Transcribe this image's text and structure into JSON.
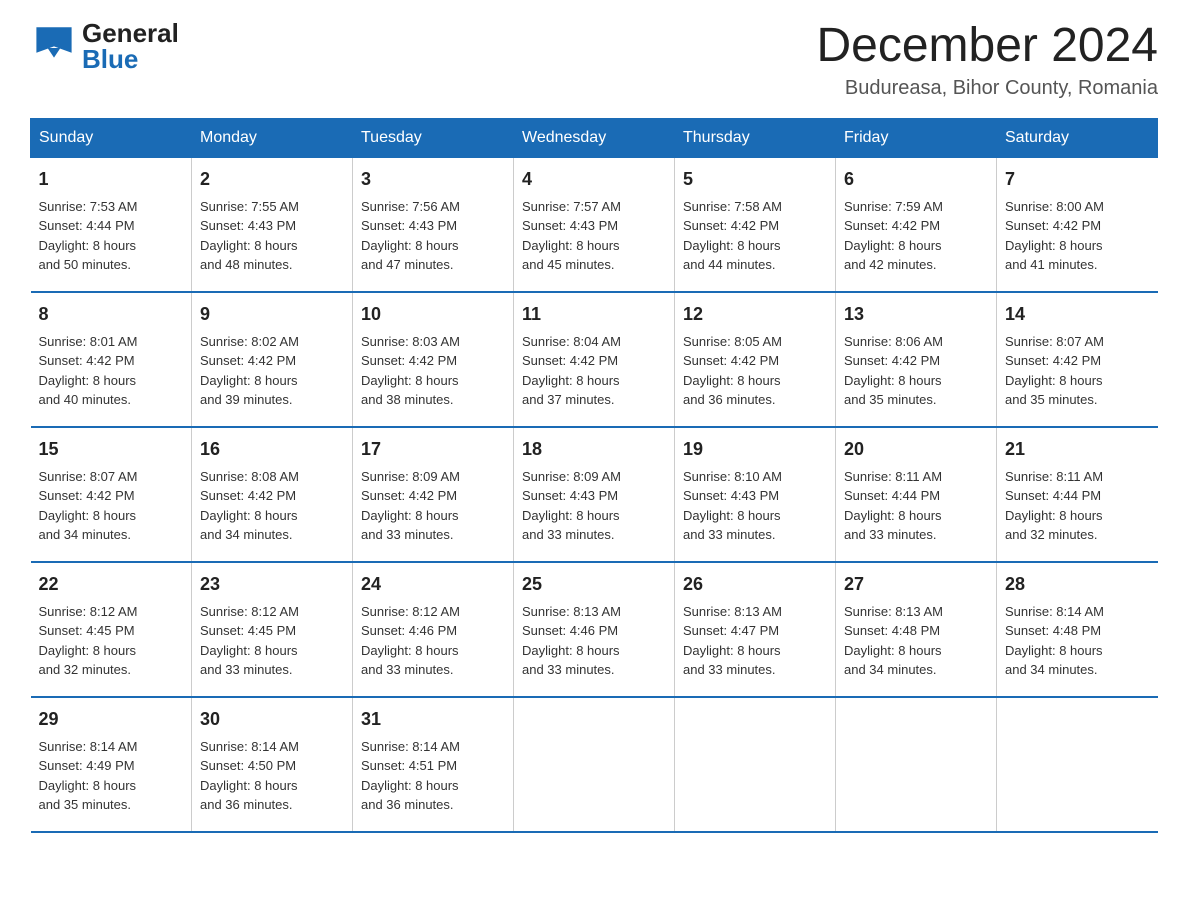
{
  "header": {
    "logo_general": "General",
    "logo_blue": "Blue",
    "month_title": "December 2024",
    "location": "Budureasa, Bihor County, Romania"
  },
  "days_of_week": [
    "Sunday",
    "Monday",
    "Tuesday",
    "Wednesday",
    "Thursday",
    "Friday",
    "Saturday"
  ],
  "weeks": [
    [
      {
        "day": "1",
        "sunrise": "7:53 AM",
        "sunset": "4:44 PM",
        "daylight": "8 hours and 50 minutes."
      },
      {
        "day": "2",
        "sunrise": "7:55 AM",
        "sunset": "4:43 PM",
        "daylight": "8 hours and 48 minutes."
      },
      {
        "day": "3",
        "sunrise": "7:56 AM",
        "sunset": "4:43 PM",
        "daylight": "8 hours and 47 minutes."
      },
      {
        "day": "4",
        "sunrise": "7:57 AM",
        "sunset": "4:43 PM",
        "daylight": "8 hours and 45 minutes."
      },
      {
        "day": "5",
        "sunrise": "7:58 AM",
        "sunset": "4:42 PM",
        "daylight": "8 hours and 44 minutes."
      },
      {
        "day": "6",
        "sunrise": "7:59 AM",
        "sunset": "4:42 PM",
        "daylight": "8 hours and 42 minutes."
      },
      {
        "day": "7",
        "sunrise": "8:00 AM",
        "sunset": "4:42 PM",
        "daylight": "8 hours and 41 minutes."
      }
    ],
    [
      {
        "day": "8",
        "sunrise": "8:01 AM",
        "sunset": "4:42 PM",
        "daylight": "8 hours and 40 minutes."
      },
      {
        "day": "9",
        "sunrise": "8:02 AM",
        "sunset": "4:42 PM",
        "daylight": "8 hours and 39 minutes."
      },
      {
        "day": "10",
        "sunrise": "8:03 AM",
        "sunset": "4:42 PM",
        "daylight": "8 hours and 38 minutes."
      },
      {
        "day": "11",
        "sunrise": "8:04 AM",
        "sunset": "4:42 PM",
        "daylight": "8 hours and 37 minutes."
      },
      {
        "day": "12",
        "sunrise": "8:05 AM",
        "sunset": "4:42 PM",
        "daylight": "8 hours and 36 minutes."
      },
      {
        "day": "13",
        "sunrise": "8:06 AM",
        "sunset": "4:42 PM",
        "daylight": "8 hours and 35 minutes."
      },
      {
        "day": "14",
        "sunrise": "8:07 AM",
        "sunset": "4:42 PM",
        "daylight": "8 hours and 35 minutes."
      }
    ],
    [
      {
        "day": "15",
        "sunrise": "8:07 AM",
        "sunset": "4:42 PM",
        "daylight": "8 hours and 34 minutes."
      },
      {
        "day": "16",
        "sunrise": "8:08 AM",
        "sunset": "4:42 PM",
        "daylight": "8 hours and 34 minutes."
      },
      {
        "day": "17",
        "sunrise": "8:09 AM",
        "sunset": "4:42 PM",
        "daylight": "8 hours and 33 minutes."
      },
      {
        "day": "18",
        "sunrise": "8:09 AM",
        "sunset": "4:43 PM",
        "daylight": "8 hours and 33 minutes."
      },
      {
        "day": "19",
        "sunrise": "8:10 AM",
        "sunset": "4:43 PM",
        "daylight": "8 hours and 33 minutes."
      },
      {
        "day": "20",
        "sunrise": "8:11 AM",
        "sunset": "4:44 PM",
        "daylight": "8 hours and 33 minutes."
      },
      {
        "day": "21",
        "sunrise": "8:11 AM",
        "sunset": "4:44 PM",
        "daylight": "8 hours and 32 minutes."
      }
    ],
    [
      {
        "day": "22",
        "sunrise": "8:12 AM",
        "sunset": "4:45 PM",
        "daylight": "8 hours and 32 minutes."
      },
      {
        "day": "23",
        "sunrise": "8:12 AM",
        "sunset": "4:45 PM",
        "daylight": "8 hours and 33 minutes."
      },
      {
        "day": "24",
        "sunrise": "8:12 AM",
        "sunset": "4:46 PM",
        "daylight": "8 hours and 33 minutes."
      },
      {
        "day": "25",
        "sunrise": "8:13 AM",
        "sunset": "4:46 PM",
        "daylight": "8 hours and 33 minutes."
      },
      {
        "day": "26",
        "sunrise": "8:13 AM",
        "sunset": "4:47 PM",
        "daylight": "8 hours and 33 minutes."
      },
      {
        "day": "27",
        "sunrise": "8:13 AM",
        "sunset": "4:48 PM",
        "daylight": "8 hours and 34 minutes."
      },
      {
        "day": "28",
        "sunrise": "8:14 AM",
        "sunset": "4:48 PM",
        "daylight": "8 hours and 34 minutes."
      }
    ],
    [
      {
        "day": "29",
        "sunrise": "8:14 AM",
        "sunset": "4:49 PM",
        "daylight": "8 hours and 35 minutes."
      },
      {
        "day": "30",
        "sunrise": "8:14 AM",
        "sunset": "4:50 PM",
        "daylight": "8 hours and 36 minutes."
      },
      {
        "day": "31",
        "sunrise": "8:14 AM",
        "sunset": "4:51 PM",
        "daylight": "8 hours and 36 minutes."
      },
      null,
      null,
      null,
      null
    ]
  ],
  "labels": {
    "sunrise": "Sunrise:",
    "sunset": "Sunset:",
    "daylight": "Daylight:"
  }
}
